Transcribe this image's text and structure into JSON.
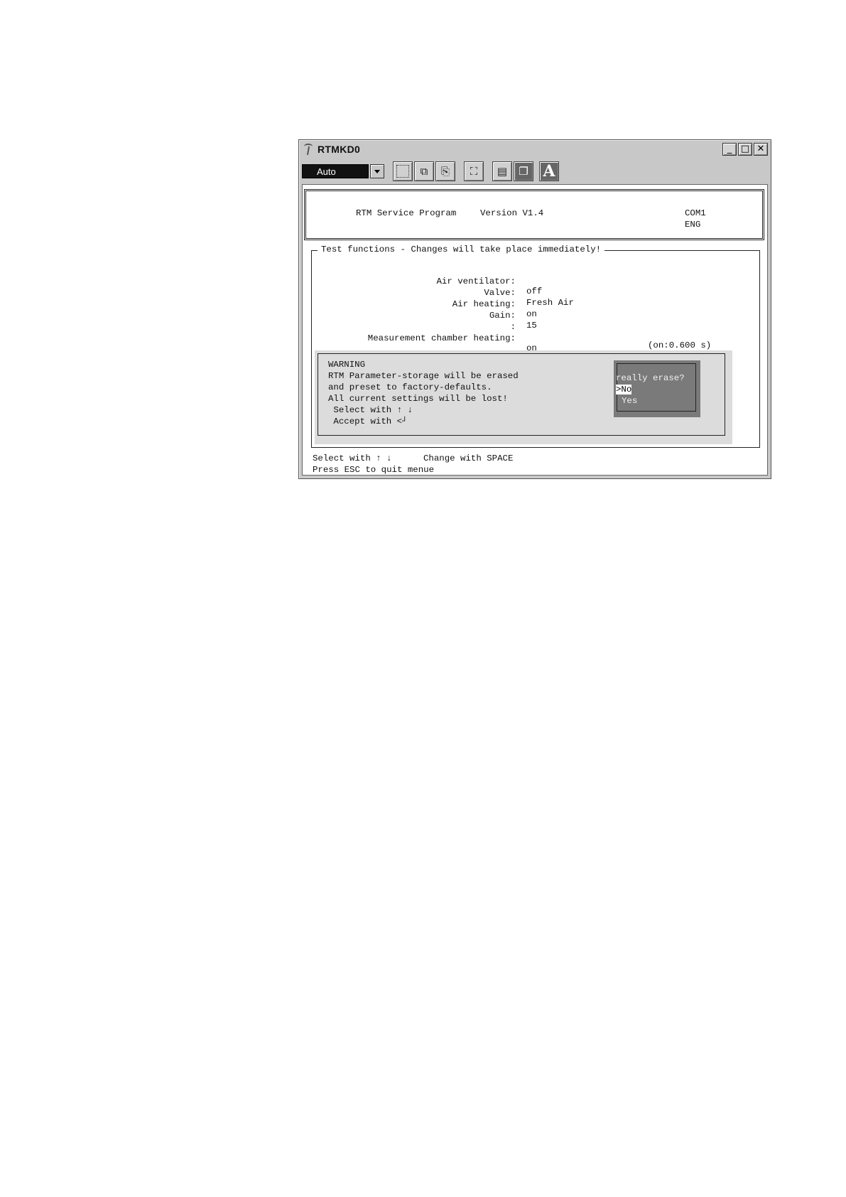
{
  "window": {
    "title": "RTMKD0"
  },
  "window_buttons": {
    "minimize": "_",
    "maximize": "□",
    "close": "✕"
  },
  "toolbar": {
    "font_size_value": "Auto"
  },
  "header": {
    "program": "RTM Service Program",
    "version": "Version V1.4",
    "port": "COM1",
    "language": "ENG"
  },
  "test_functions": {
    "title": "Test functions - Changes will take place immediately!",
    "rows": [
      {
        "label": "Air ventilator:",
        "value": "off"
      },
      {
        "label": "Valve:",
        "value": "Fresh Air"
      },
      {
        "label": "Air heating:",
        "value": "on"
      },
      {
        "label": "Gain:",
        "value": "15"
      },
      {
        "label": ":",
        "value": ""
      },
      {
        "label": "Measurement chamber heating:",
        "value": "on"
      }
    ],
    "timing": "(on:0.600 s)"
  },
  "warning": {
    "lines": [
      "WARNING",
      "RTM Parameter-storage will be erased",
      "and preset to factory-defaults.",
      "All current settings will be lost!",
      " Select with ↑ ↓",
      " Accept with <┘"
    ],
    "prompt": "really erase?",
    "option_no": ">No",
    "option_yes": "Yes"
  },
  "footer": {
    "select": "Select with ↑ ↓",
    "change": "Change with SPACE",
    "quit": "Press ESC to quit menue"
  }
}
